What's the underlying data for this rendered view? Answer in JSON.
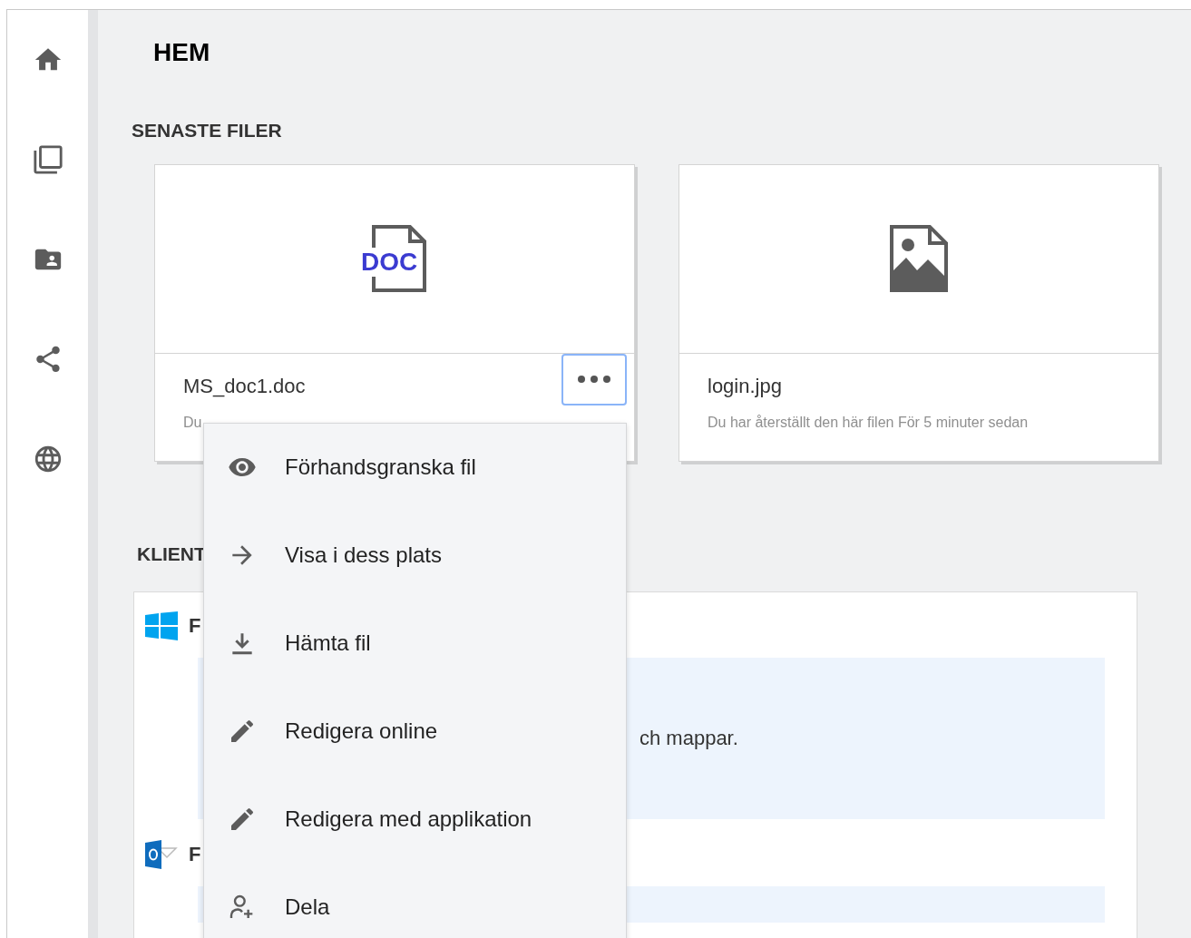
{
  "page": {
    "title": "HEM"
  },
  "recent_files": {
    "heading": "SENASTE FILER",
    "files": [
      {
        "kind": "doc",
        "type_label": "DOC",
        "name": "MS_doc1.doc",
        "subtitle": "Du",
        "menu_open": true
      },
      {
        "kind": "image",
        "name": "login.jpg",
        "subtitle": "Du har återställt den här filen För 5 minuter sedan",
        "menu_open": false
      }
    ]
  },
  "clients": {
    "heading": "KLIENT",
    "entries": [
      {
        "kind": "windows",
        "title": "F",
        "note": "ch mappar."
      },
      {
        "kind": "outlook",
        "title": "F"
      }
    ]
  },
  "context_menu": {
    "items": [
      {
        "kind": "preview",
        "label": "Förhandsgranska fil"
      },
      {
        "kind": "locate",
        "label": "Visa i dess plats"
      },
      {
        "kind": "download",
        "label": "Hämta fil"
      },
      {
        "kind": "edit",
        "label": "Redigera online"
      },
      {
        "kind": "edit",
        "label": "Redigera med applikation"
      },
      {
        "kind": "share",
        "label": "Dela"
      }
    ]
  }
}
